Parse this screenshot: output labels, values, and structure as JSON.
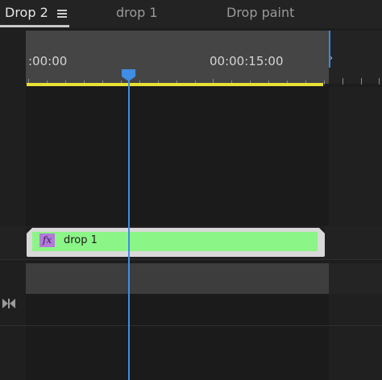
{
  "tabs": {
    "active": "Drop 2",
    "others": [
      "drop 1",
      "Drop paint"
    ]
  },
  "ruler": {
    "time_start": ":00:00",
    "time_mid": "00:00:15:00"
  },
  "clip": {
    "fx_label": "fx",
    "name": "drop 1"
  },
  "icons": {
    "menu": "hamburger-menu-icon",
    "fx": "fx-badge-icon",
    "playhead": "playhead-icon",
    "trim": "bow-tie-icon"
  },
  "colors": {
    "playhead": "#3f8de4",
    "work_area": "#e8e133",
    "clip": "#8cf587",
    "fx_badge": "#b279d8"
  }
}
